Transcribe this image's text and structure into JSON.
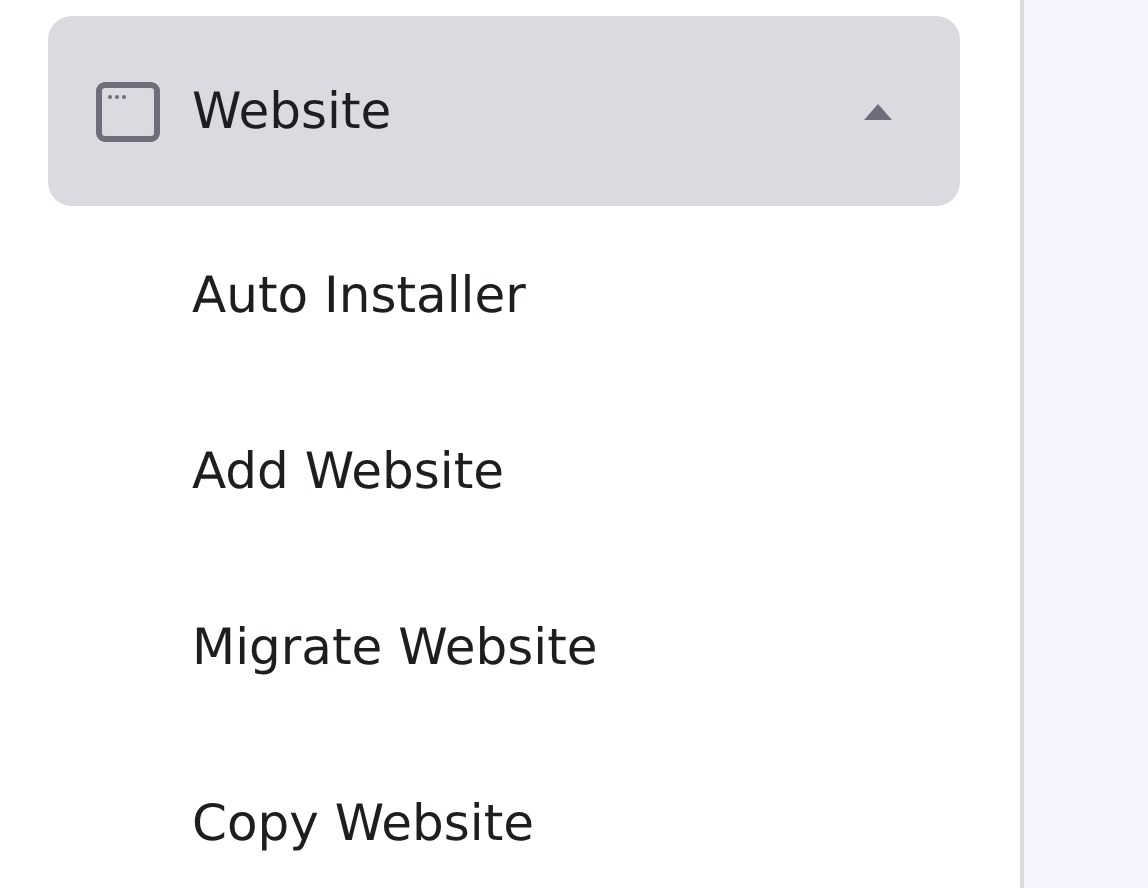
{
  "menu_group": {
    "label": "Website",
    "expanded": true,
    "items": [
      {
        "label": "Auto Installer"
      },
      {
        "label": "Add Website"
      },
      {
        "label": "Migrate Website"
      },
      {
        "label": "Copy Website"
      }
    ]
  }
}
